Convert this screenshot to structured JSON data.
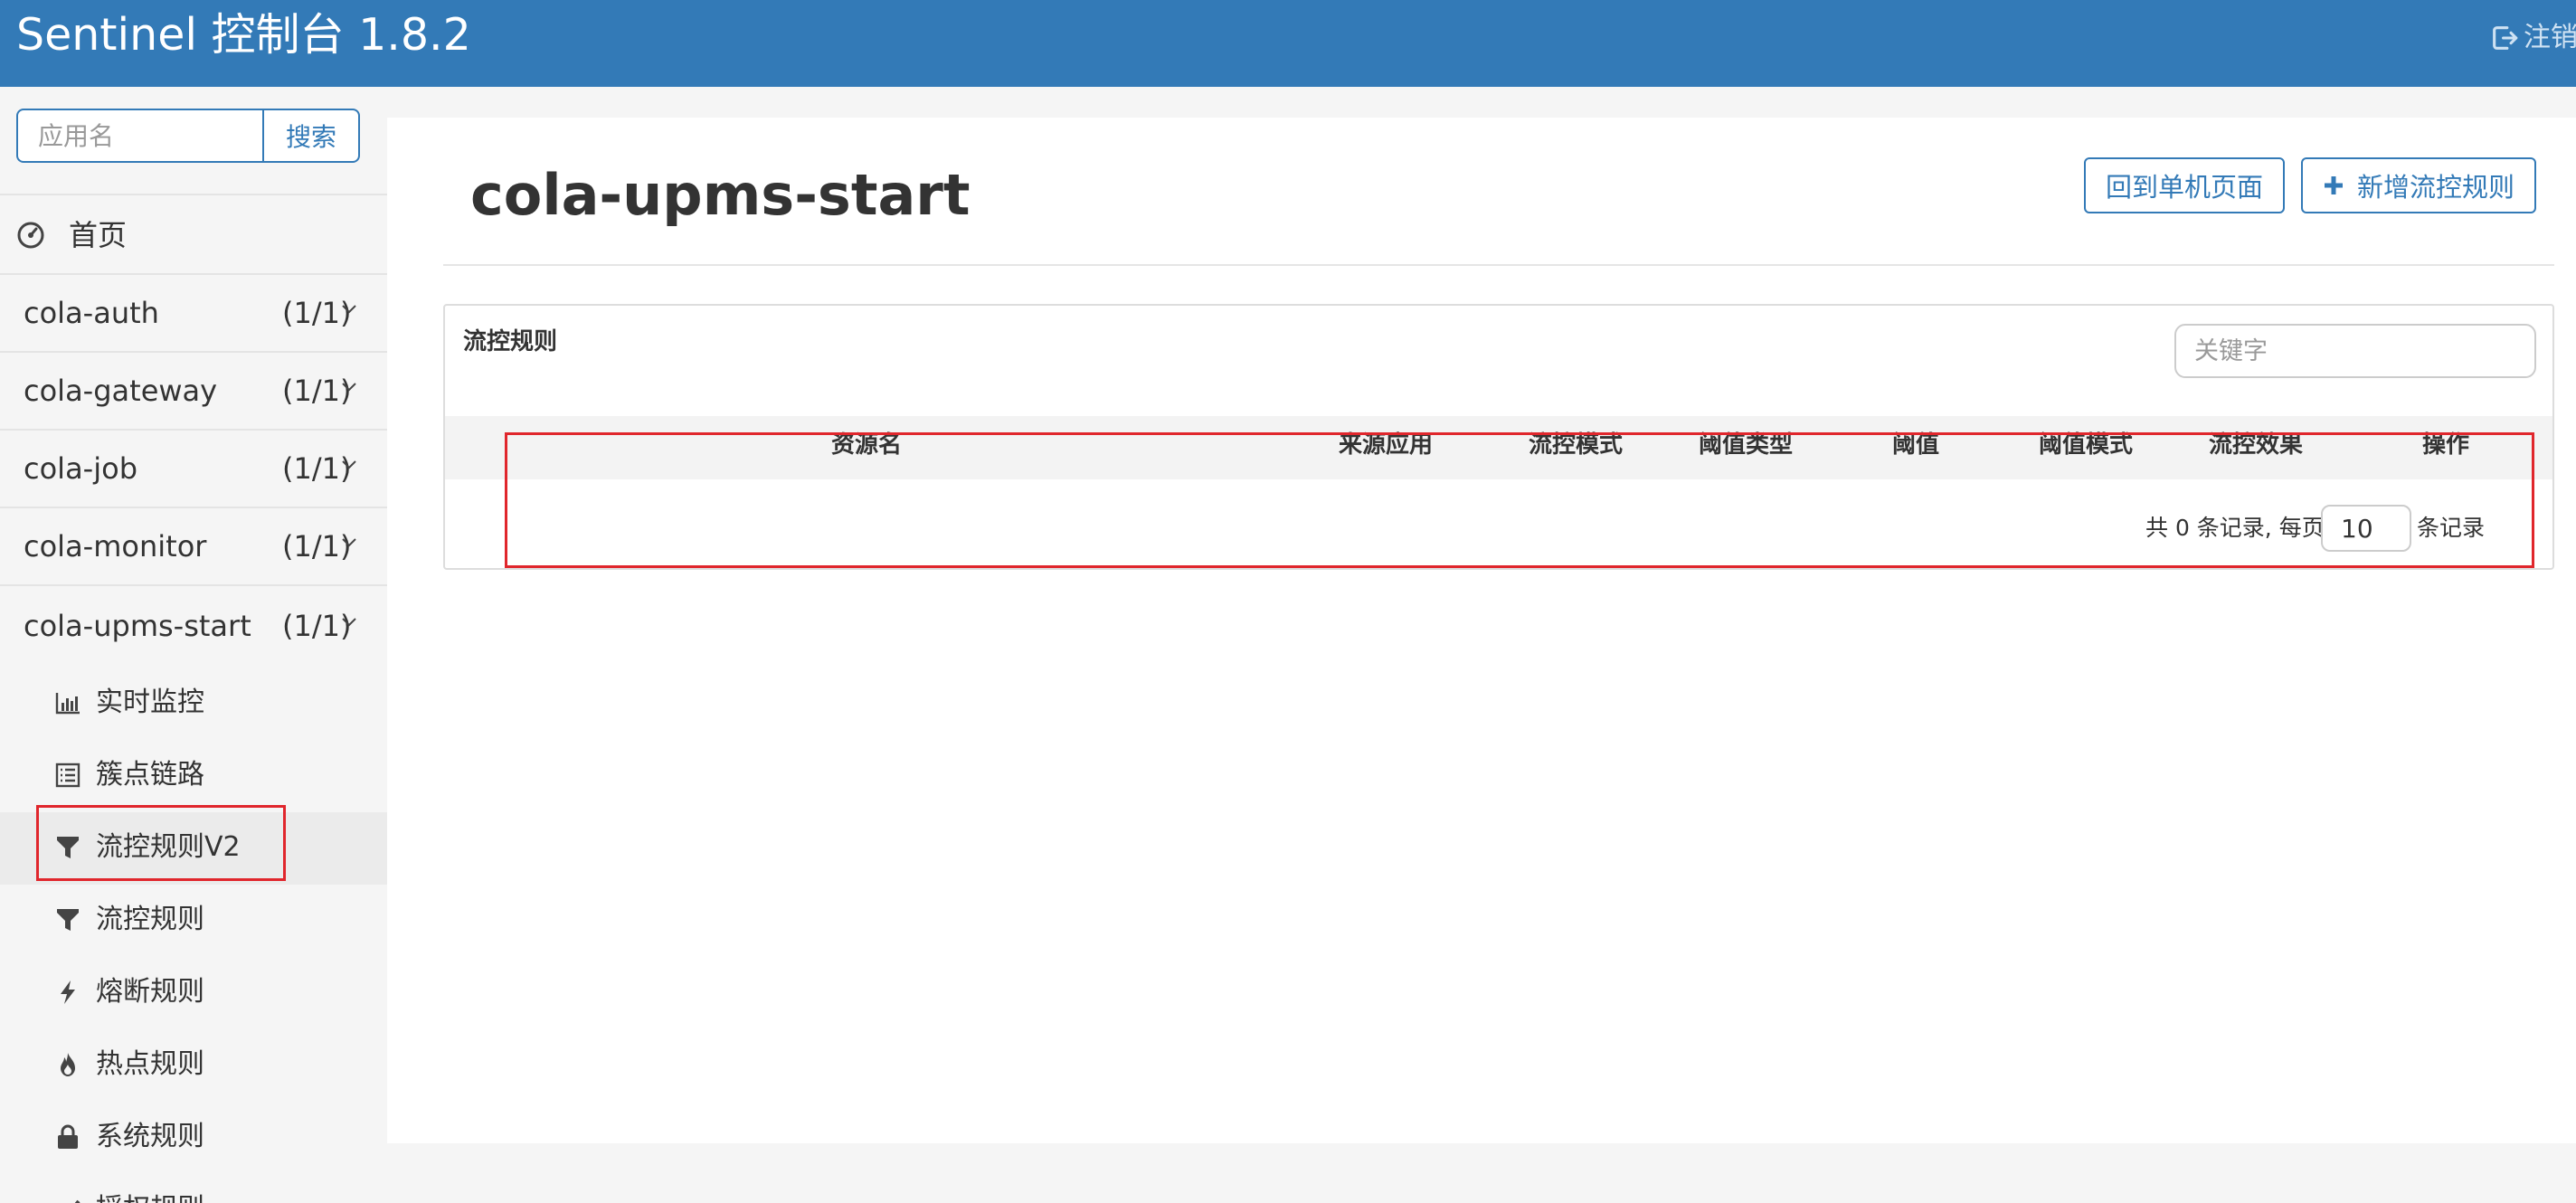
{
  "header": {
    "brand": "Sentinel 控制台 1.8.2",
    "logout_label": "注销"
  },
  "sidebar": {
    "search": {
      "placeholder": "应用名",
      "button_label": "搜索"
    },
    "home_label": "首页",
    "apps": [
      {
        "name": "cola-auth",
        "count": "(1/1)"
      },
      {
        "name": "cola-gateway",
        "count": "(1/1)"
      },
      {
        "name": "cola-job",
        "count": "(1/1)"
      },
      {
        "name": "cola-monitor",
        "count": "(1/1)"
      },
      {
        "name": "cola-upms-start",
        "count": "(1/1)",
        "expanded": true
      }
    ],
    "submenu": [
      {
        "label": "实时监控",
        "icon": "bar-chart-icon"
      },
      {
        "label": "簇点链路",
        "icon": "list-icon"
      },
      {
        "label": "流控规则V2",
        "icon": "filter-icon",
        "active": true
      },
      {
        "label": "流控规则",
        "icon": "filter-icon"
      },
      {
        "label": "熔断规则",
        "icon": "flash-icon"
      },
      {
        "label": "热点规则",
        "icon": "fire-icon"
      },
      {
        "label": "系统规则",
        "icon": "lock-icon"
      },
      {
        "label": "授权规则",
        "icon": "check-icon"
      }
    ]
  },
  "main": {
    "title": "cola-upms-start",
    "back_button": "回到单机页面",
    "add_button": "新增流控规则",
    "card": {
      "title": "流控规则",
      "keyword_placeholder": "关键字",
      "columns": [
        "资源名",
        "来源应用",
        "流控模式",
        "阈值类型",
        "阈值",
        "阈值模式",
        "流控效果",
        "操作"
      ],
      "rows": [],
      "pager": {
        "total_prefix": "共 0 条记录, 每页",
        "page_size": "10",
        "suffix": "条记录"
      }
    }
  },
  "colors": {
    "primary": "#337ab7",
    "highlight": "#e0262c"
  }
}
